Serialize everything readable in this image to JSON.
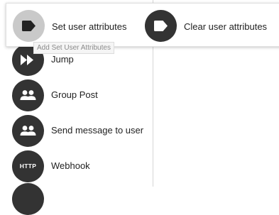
{
  "actions": [
    {
      "label": "Jump",
      "icon": "fast-forward-icon"
    },
    {
      "label": "Group Post",
      "icon": "group-icon"
    },
    {
      "label": "Send message to user",
      "icon": "group-icon"
    },
    {
      "label": "Webhook",
      "icon": "http-icon",
      "icon_text": "HTTP"
    }
  ],
  "submenu": {
    "options": [
      {
        "label": "Set user attributes",
        "icon": "tag-icon",
        "state": "hovered"
      },
      {
        "label": "Clear user attributes",
        "icon": "tag-icon"
      }
    ],
    "tooltip": "Add Set User Attributes"
  },
  "colors": {
    "icon_circle": "#333333",
    "hover_circle": "#c9c9c9",
    "panel_divider": "#d6d6d6"
  }
}
